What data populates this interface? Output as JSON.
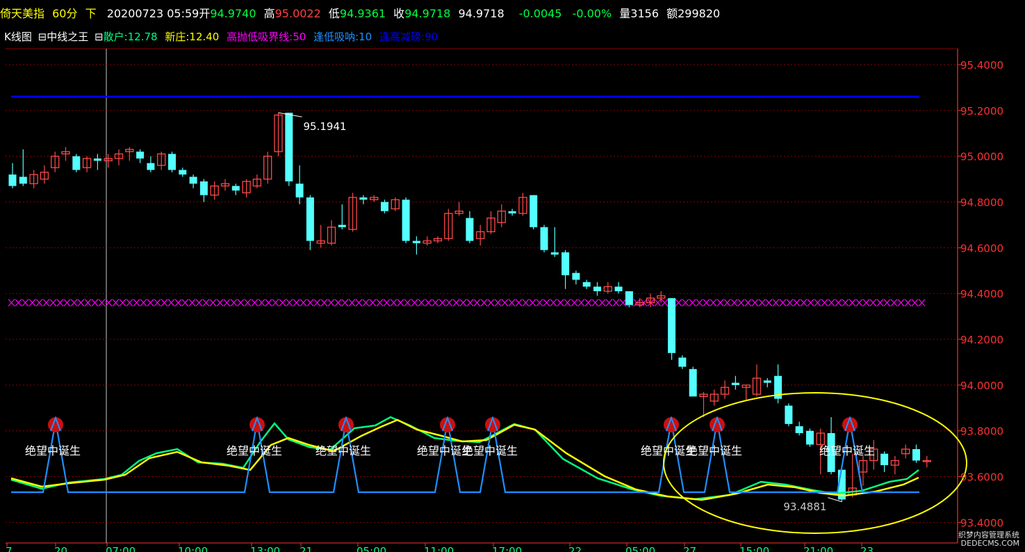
{
  "header": {
    "name": "倚天美指",
    "period": "60分",
    "arrow": "下",
    "datetime": "20200723 05:59",
    "open_label": "开",
    "open": "94.9740",
    "high_label": "高",
    "high": "95.0022",
    "low_label": "低",
    "low": "94.9361",
    "close_label": "收",
    "close": "94.9718",
    "last": "94.9718",
    "change": "-0.0045",
    "change_pct": "-0.00%",
    "vol_label": "量",
    "vol": "3156",
    "amt_label": "额",
    "amt": "299820"
  },
  "indicator_bar": {
    "kline": "K线图",
    "name": "中线之王",
    "retail": "散户:12.78",
    "banker": "新庄:12.40",
    "boundary": "高抛低吸界线:50",
    "buy_low": "逢低吸呐:10",
    "sell_high": "逢高减磅:90"
  },
  "colors": {
    "up": "#ff4a4a",
    "down": "#54ffff",
    "grid": "#8b0000",
    "axis": "#ff3030",
    "retail_line": "#00ff80",
    "banker_line": "#ffff00",
    "signal_line": "#1e90ff",
    "blue_level": "#0000ff",
    "magenta_level": "#ff00ff",
    "ellipse": "#ffff00"
  },
  "chart_data": {
    "type": "candlestick",
    "y_ticks": [
      "95.4000",
      "95.2000",
      "95.0000",
      "94.8000",
      "94.6000",
      "94.4000",
      "94.2000",
      "94.0000",
      "93.8000",
      "93.6000",
      "93.4000"
    ],
    "ylim": [
      93.31,
      95.47
    ],
    "candles": [
      [
        94.92,
        94.87,
        94.97,
        94.86
      ],
      [
        94.91,
        94.88,
        95.03,
        94.87
      ],
      [
        94.88,
        94.92,
        94.94,
        94.86
      ],
      [
        94.9,
        94.93,
        94.96,
        94.88
      ],
      [
        94.95,
        95.0,
        95.02,
        94.93
      ],
      [
        95.01,
        95.02,
        95.04,
        94.98
      ],
      [
        95.0,
        94.94,
        95.01,
        94.93
      ],
      [
        94.95,
        94.99,
        95.0,
        94.93
      ],
      [
        94.99,
        94.98,
        95.01,
        94.94
      ],
      [
        94.98,
        94.99,
        95.01,
        94.95
      ],
      [
        94.99,
        95.01,
        95.03,
        94.96
      ],
      [
        95.02,
        95.03,
        95.04,
        94.98
      ],
      [
        95.02,
        94.99,
        95.03,
        94.97
      ],
      [
        94.97,
        94.94,
        95.0,
        94.93
      ],
      [
        94.96,
        95.01,
        95.02,
        94.94
      ],
      [
        95.01,
        94.94,
        95.02,
        94.93
      ],
      [
        94.94,
        94.92,
        94.95,
        94.91
      ],
      [
        94.91,
        94.88,
        94.92,
        94.86
      ],
      [
        94.89,
        94.83,
        94.9,
        94.8
      ],
      [
        94.83,
        94.87,
        94.89,
        94.81
      ],
      [
        94.87,
        94.88,
        94.9,
        94.85
      ],
      [
        94.87,
        94.85,
        94.88,
        94.83
      ],
      [
        94.84,
        94.89,
        94.9,
        94.82
      ],
      [
        94.87,
        94.9,
        94.92,
        94.86
      ],
      [
        94.9,
        95.0,
        95.02,
        94.88
      ],
      [
        95.02,
        95.18,
        95.19,
        95.0
      ],
      [
        95.19,
        94.89,
        95.19,
        94.87
      ],
      [
        94.88,
        94.82,
        94.96,
        94.79
      ],
      [
        94.82,
        94.63,
        94.83,
        94.59
      ],
      [
        94.62,
        94.63,
        94.7,
        94.6
      ],
      [
        94.62,
        94.69,
        94.72,
        94.61
      ],
      [
        94.7,
        94.69,
        94.79,
        94.68
      ],
      [
        94.68,
        94.82,
        94.84,
        94.67
      ],
      [
        94.82,
        94.81,
        94.83,
        94.79
      ],
      [
        94.81,
        94.82,
        94.83,
        94.8
      ],
      [
        94.8,
        94.76,
        94.81,
        94.75
      ],
      [
        94.77,
        94.81,
        94.82,
        94.76
      ],
      [
        94.81,
        94.63,
        94.82,
        94.62
      ],
      [
        94.63,
        94.62,
        94.65,
        94.57
      ],
      [
        94.62,
        94.63,
        94.65,
        94.61
      ],
      [
        94.63,
        94.64,
        94.65,
        94.62
      ],
      [
        94.64,
        94.75,
        94.77,
        94.63
      ],
      [
        94.75,
        94.76,
        94.8,
        94.74
      ],
      [
        94.73,
        94.63,
        94.76,
        94.62
      ],
      [
        94.64,
        94.67,
        94.7,
        94.61
      ],
      [
        94.67,
        94.73,
        94.76,
        94.66
      ],
      [
        94.71,
        94.76,
        94.79,
        94.69
      ],
      [
        94.76,
        94.75,
        94.77,
        94.74
      ],
      [
        94.75,
        94.82,
        94.84,
        94.74
      ],
      [
        94.83,
        94.69,
        94.83,
        94.68
      ],
      [
        94.69,
        94.59,
        94.7,
        94.58
      ],
      [
        94.58,
        94.57,
        94.69,
        94.56
      ],
      [
        94.58,
        94.48,
        94.59,
        94.42
      ],
      [
        94.49,
        94.46,
        94.5,
        94.44
      ],
      [
        94.45,
        94.43,
        94.46,
        94.42
      ],
      [
        94.43,
        94.41,
        94.45,
        94.39
      ],
      [
        94.41,
        94.43,
        94.45,
        94.4
      ],
      [
        94.43,
        94.41,
        94.45,
        94.4
      ],
      [
        94.41,
        94.35,
        94.41,
        94.34
      ],
      [
        94.35,
        94.36,
        94.38,
        94.34
      ],
      [
        94.36,
        94.38,
        94.4,
        94.34
      ],
      [
        94.38,
        94.39,
        94.41,
        94.36
      ],
      [
        94.38,
        94.14,
        94.38,
        94.11
      ],
      [
        94.12,
        94.08,
        94.13,
        94.07
      ],
      [
        94.07,
        93.95,
        94.08,
        94.04
      ],
      [
        93.95,
        93.96,
        93.97,
        93.86
      ],
      [
        93.93,
        93.96,
        93.98,
        93.91
      ],
      [
        93.96,
        93.99,
        94.02,
        93.94
      ],
      [
        94.01,
        94.0,
        94.04,
        93.98
      ],
      [
        93.99,
        94.0,
        94.0,
        93.93
      ],
      [
        93.96,
        94.03,
        94.09,
        93.95
      ],
      [
        94.02,
        94.01,
        94.03,
        93.99
      ],
      [
        94.04,
        93.94,
        94.09,
        93.92
      ],
      [
        93.91,
        93.83,
        93.92,
        93.82
      ],
      [
        93.82,
        93.79,
        93.84,
        93.78
      ],
      [
        93.8,
        93.74,
        93.81,
        93.73
      ],
      [
        93.74,
        93.79,
        93.81,
        93.61
      ],
      [
        93.79,
        93.62,
        93.86,
        93.61
      ],
      [
        93.63,
        93.5,
        93.64,
        93.49
      ],
      [
        93.52,
        93.55,
        93.7,
        93.51
      ],
      [
        93.62,
        93.67,
        93.69,
        93.56
      ],
      [
        93.67,
        93.72,
        93.76,
        93.63
      ],
      [
        93.7,
        93.65,
        93.71,
        93.62
      ],
      [
        93.65,
        93.67,
        93.69,
        93.61
      ],
      [
        93.7,
        93.72,
        93.74,
        93.68
      ],
      [
        93.72,
        93.67,
        93.74,
        93.66
      ],
      [
        93.67,
        93.67,
        93.69,
        93.64
      ]
    ],
    "annotations": {
      "high_label": "95.1941",
      "low_label": "93.4881",
      "signal_text": "绝望中诞生",
      "level_lines": [
        95.26,
        94.36
      ]
    },
    "x_tick_labels": [
      "7",
      "20",
      "07:00",
      "10:00",
      "13:00",
      "21",
      "05:00",
      "11:00",
      "17:00",
      "22",
      "05:00",
      "27",
      "15:00",
      "21:00",
      "23"
    ]
  },
  "watermark": {
    "line1": "织梦内容管理系统",
    "line2": "DEDECMS.COM"
  }
}
